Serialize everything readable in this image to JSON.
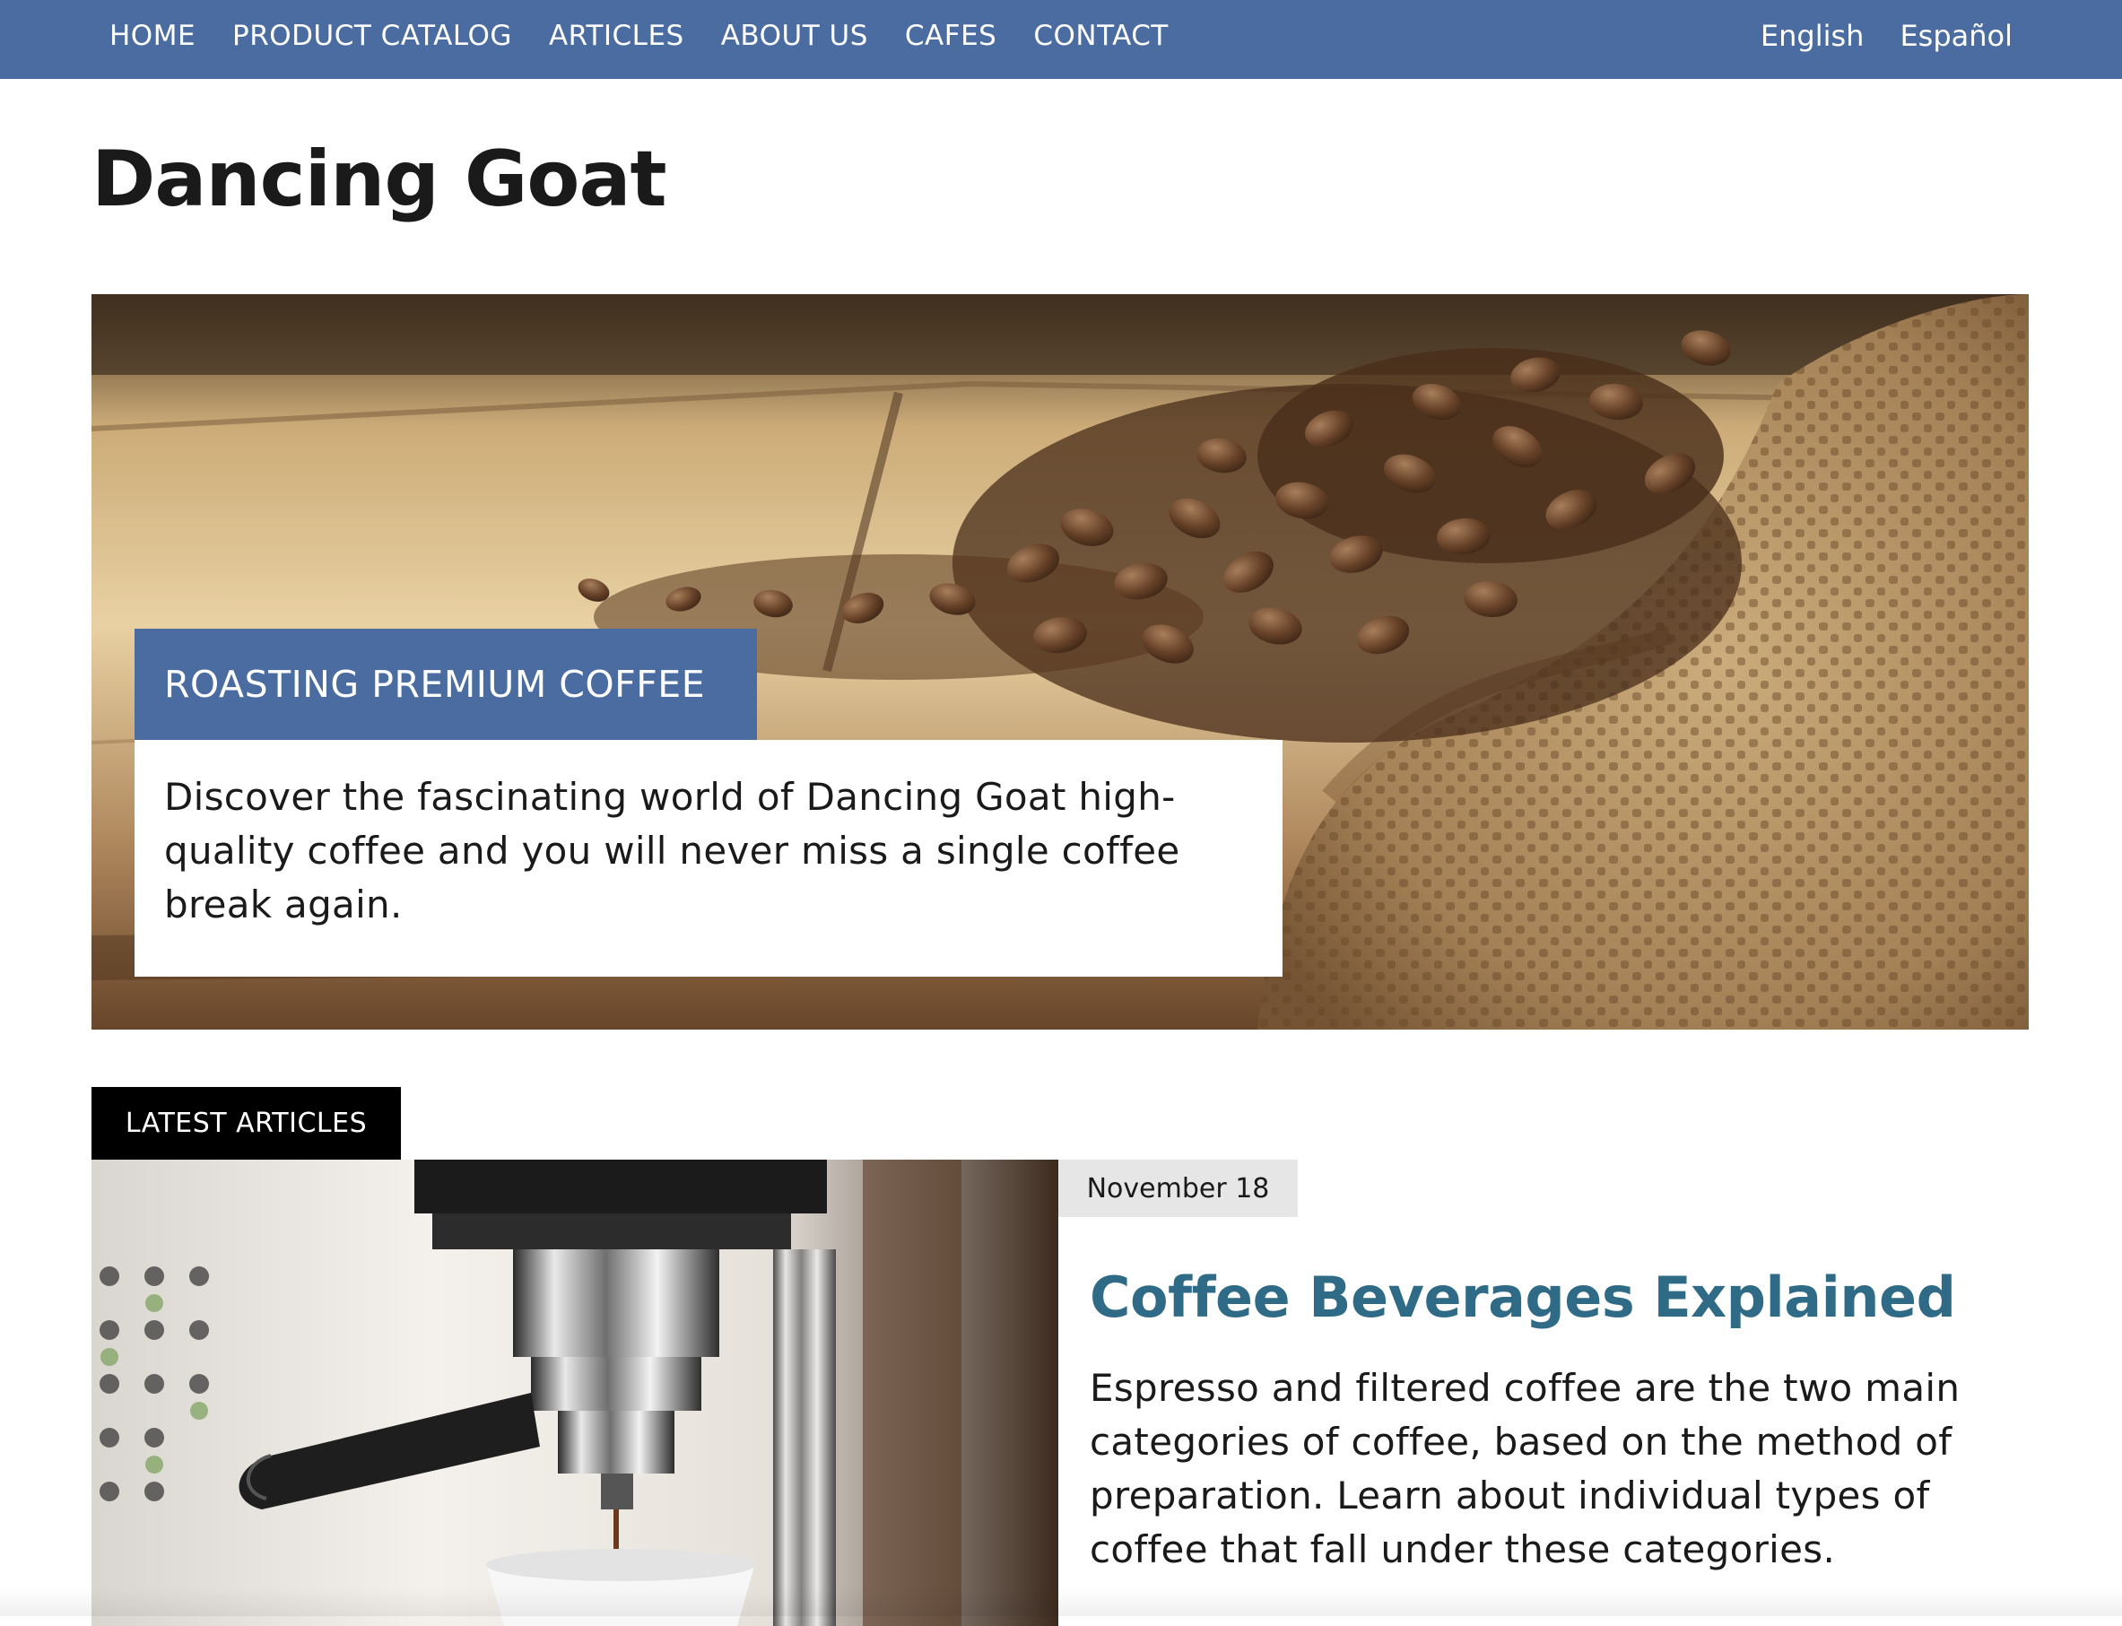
{
  "nav": {
    "items": [
      {
        "label": "HOME"
      },
      {
        "label": "PRODUCT CATALOG"
      },
      {
        "label": "ARTICLES"
      },
      {
        "label": "ABOUT US"
      },
      {
        "label": "CAFES"
      },
      {
        "label": "CONTACT"
      }
    ],
    "languages": [
      {
        "label": "English"
      },
      {
        "label": "Español"
      }
    ]
  },
  "site": {
    "title": "Dancing Goat"
  },
  "hero": {
    "badge": "ROASTING PREMIUM COFFEE",
    "text": "Discover the fascinating world of Dancing Goat high-quality coffee and you will never miss a single coffee break again.",
    "image": "coffee-beans-burlap-sack-image"
  },
  "latest": {
    "label": "LATEST ARTICLES",
    "article": {
      "date": "November 18",
      "title": "Coffee Beverages Explained",
      "summary": "Espresso and filtered coffee are the two main categories of coffee, based on the method of preparation. Learn about individual types of coffee that fall under these categories.",
      "image": "espresso-machine-image"
    }
  },
  "colors": {
    "nav_bg": "#4a6ca0",
    "badge_bg": "#4a6ca0",
    "article_title": "#2f6a86",
    "latest_label_bg": "#000000",
    "date_badge_bg": "#e6e6e6"
  }
}
